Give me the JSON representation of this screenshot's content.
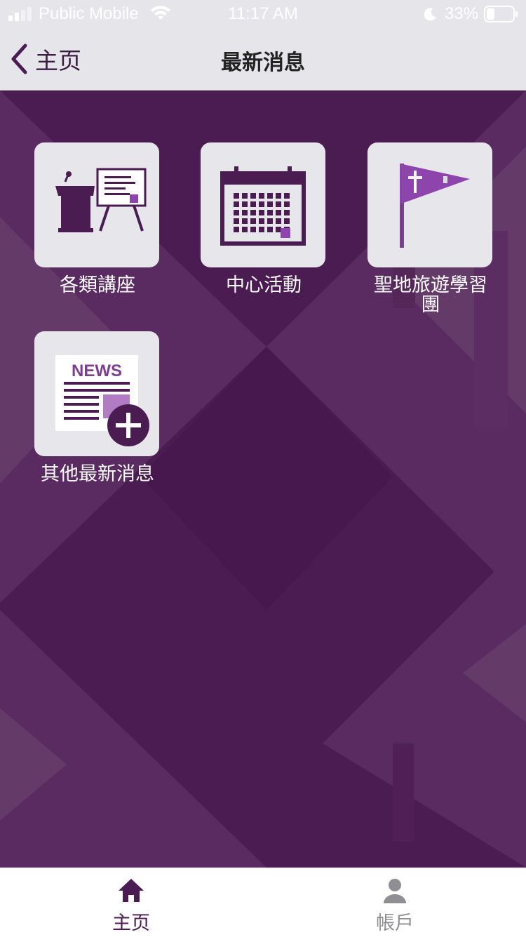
{
  "status_bar": {
    "carrier": "Public Mobile",
    "time": "11:17 AM",
    "battery": "33%"
  },
  "nav": {
    "back_label": "主页",
    "title": "最新消息"
  },
  "tiles": [
    {
      "label": "各類講座",
      "icon": "lecture-podium-icon"
    },
    {
      "label": "中心活動",
      "icon": "calendar-icon"
    },
    {
      "label": "聖地旅遊學習團",
      "icon": "pennant-flag-icon"
    },
    {
      "label": "其他最新消息",
      "icon": "news-plus-icon",
      "icon_text": "NEWS"
    }
  ],
  "tab_bar": {
    "items": [
      {
        "label": "主页",
        "icon": "home-icon",
        "active": true
      },
      {
        "label": "帳戶",
        "icon": "person-icon",
        "active": false
      }
    ]
  },
  "colors": {
    "brand_purple": "#4b1c52",
    "accent_purple": "#8e44ad",
    "tile_bg": "#e6e6eb",
    "navbar_bg": "#e5e5ea",
    "inactive_tab": "#8e8e93"
  }
}
